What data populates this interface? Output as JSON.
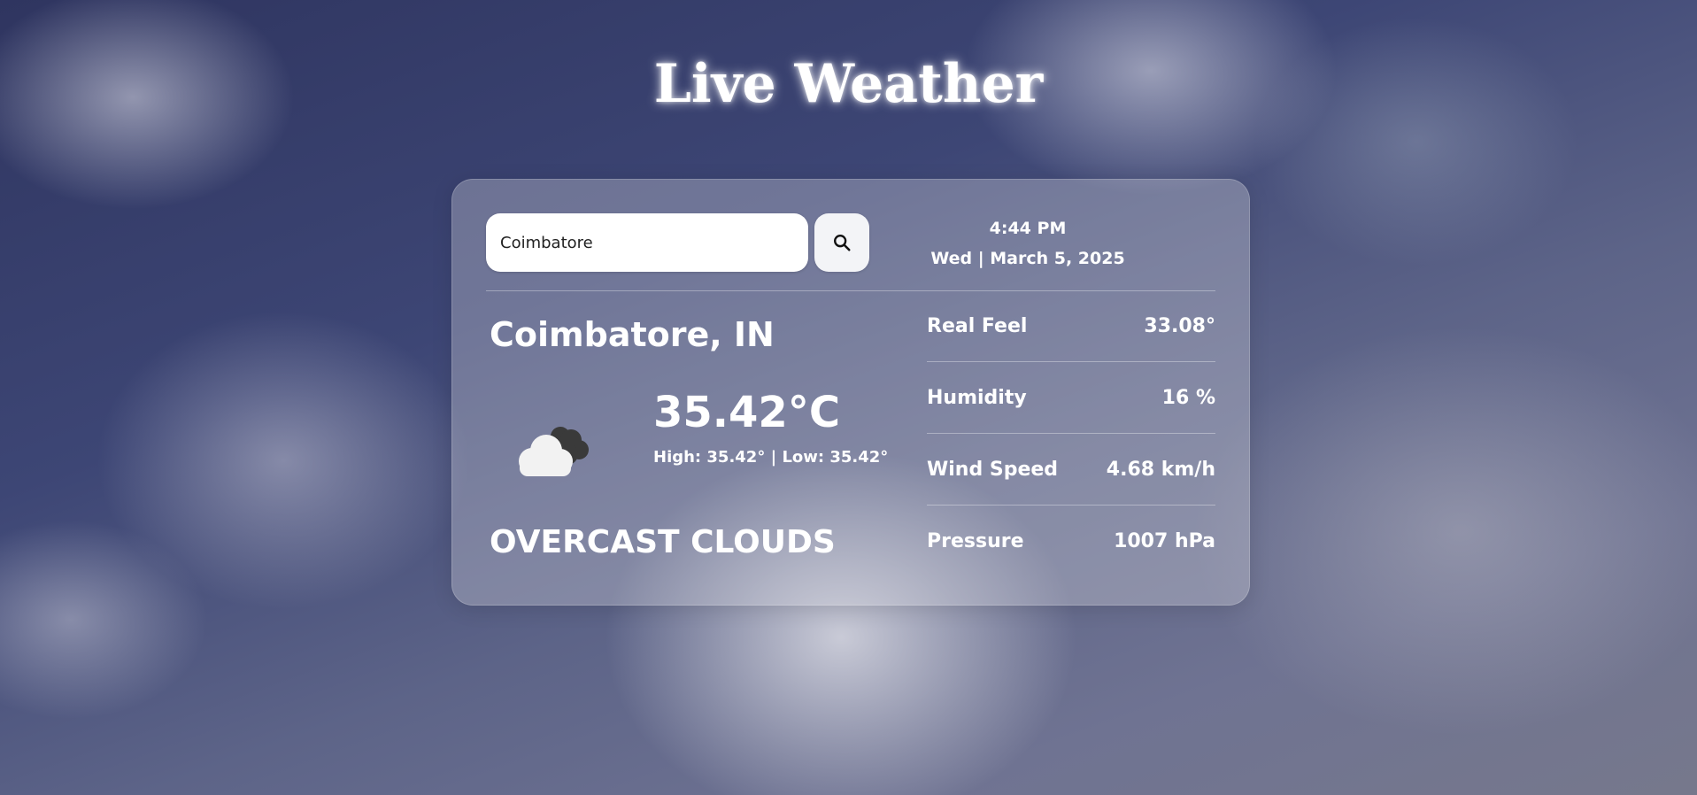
{
  "header": {
    "title": "Live Weather"
  },
  "search": {
    "value": "Coimbatore",
    "button_icon": "search-icon"
  },
  "datetime": {
    "time": "4:44 PM",
    "date": "Wed | March 5, 2025"
  },
  "current": {
    "location": "Coimbatore, IN",
    "icon": "overcast-clouds-icon",
    "temperature": "35.42°C",
    "high_low": "High: 35.42° | Low: 35.42°",
    "description": "OVERCAST CLOUDS"
  },
  "details": [
    {
      "label": "Real Feel",
      "value": "33.08°"
    },
    {
      "label": "Humidity",
      "value": "16 %"
    },
    {
      "label": "Wind Speed",
      "value": "4.68 km/h"
    },
    {
      "label": "Pressure",
      "value": "1007 hPa"
    }
  ]
}
